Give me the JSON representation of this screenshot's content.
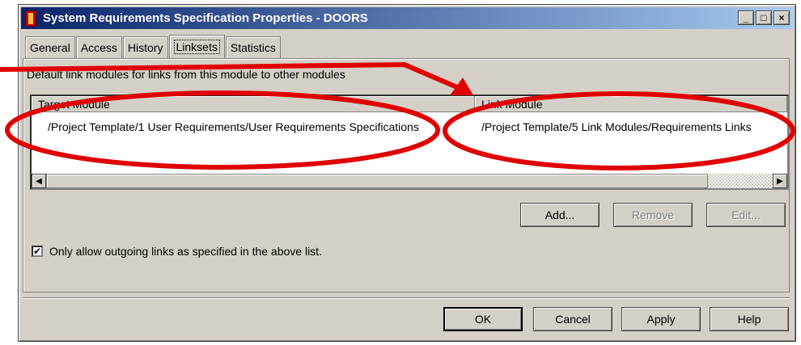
{
  "window": {
    "title": "System Requirements Specification Properties - DOORS",
    "minimize": "_",
    "maximize": "□",
    "close": "×"
  },
  "tabs": [
    "General",
    "Access",
    "History",
    "Linksets",
    "Statistics"
  ],
  "active_tab": "Linksets",
  "description": "Default link modules for links from this module to other modules",
  "list": {
    "columns": [
      "Target Module",
      "Link Module"
    ],
    "rows": [
      [
        "/Project Template/1 User Requirements/User Requirements Specifications",
        "/Project Template/5 Link Modules/Requirements Links"
      ]
    ]
  },
  "scroll": {
    "left": "◀",
    "right": "▶"
  },
  "actions": {
    "add": "Add...",
    "remove": "Remove",
    "edit": "Edit..."
  },
  "checkbox": {
    "label": "Only allow outgoing links as specified in the above list.",
    "checked": true,
    "mark": "✔"
  },
  "footer": {
    "ok": "OK",
    "cancel": "Cancel",
    "apply": "Apply",
    "help": "Help"
  },
  "annotation_color": "#e00000"
}
